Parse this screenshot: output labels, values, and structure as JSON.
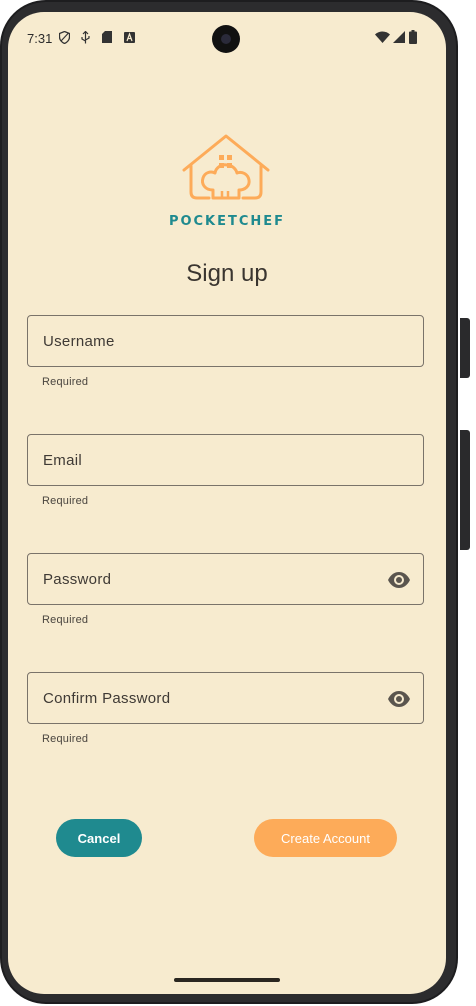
{
  "status_bar": {
    "time": "7:31",
    "left_icons": [
      "shield-icon",
      "usb-debug-icon",
      "sd-card-icon",
      "keyboard-a-icon"
    ],
    "right_icons": [
      "wifi-icon",
      "cellular-signal-icon",
      "battery-icon"
    ]
  },
  "logo": {
    "icon": "chef-house-logo-icon",
    "brand_name": "POCKETCHEF"
  },
  "page": {
    "title": "Sign up"
  },
  "form": {
    "fields": [
      {
        "label": "Username",
        "helper": "Required",
        "has_visibility_toggle": false
      },
      {
        "label": "Email",
        "helper": "Required",
        "has_visibility_toggle": false
      },
      {
        "label": "Password",
        "helper": "Required",
        "has_visibility_toggle": true
      },
      {
        "label": "Confirm Password",
        "helper": "Required",
        "has_visibility_toggle": true
      }
    ]
  },
  "actions": {
    "cancel_label": "Cancel",
    "create_label": "Create Account"
  },
  "colors": {
    "background": "#f7ebcf",
    "primary_teal": "#1f8a8f",
    "accent_orange": "#fdab59",
    "text_dark": "#3a3530"
  }
}
